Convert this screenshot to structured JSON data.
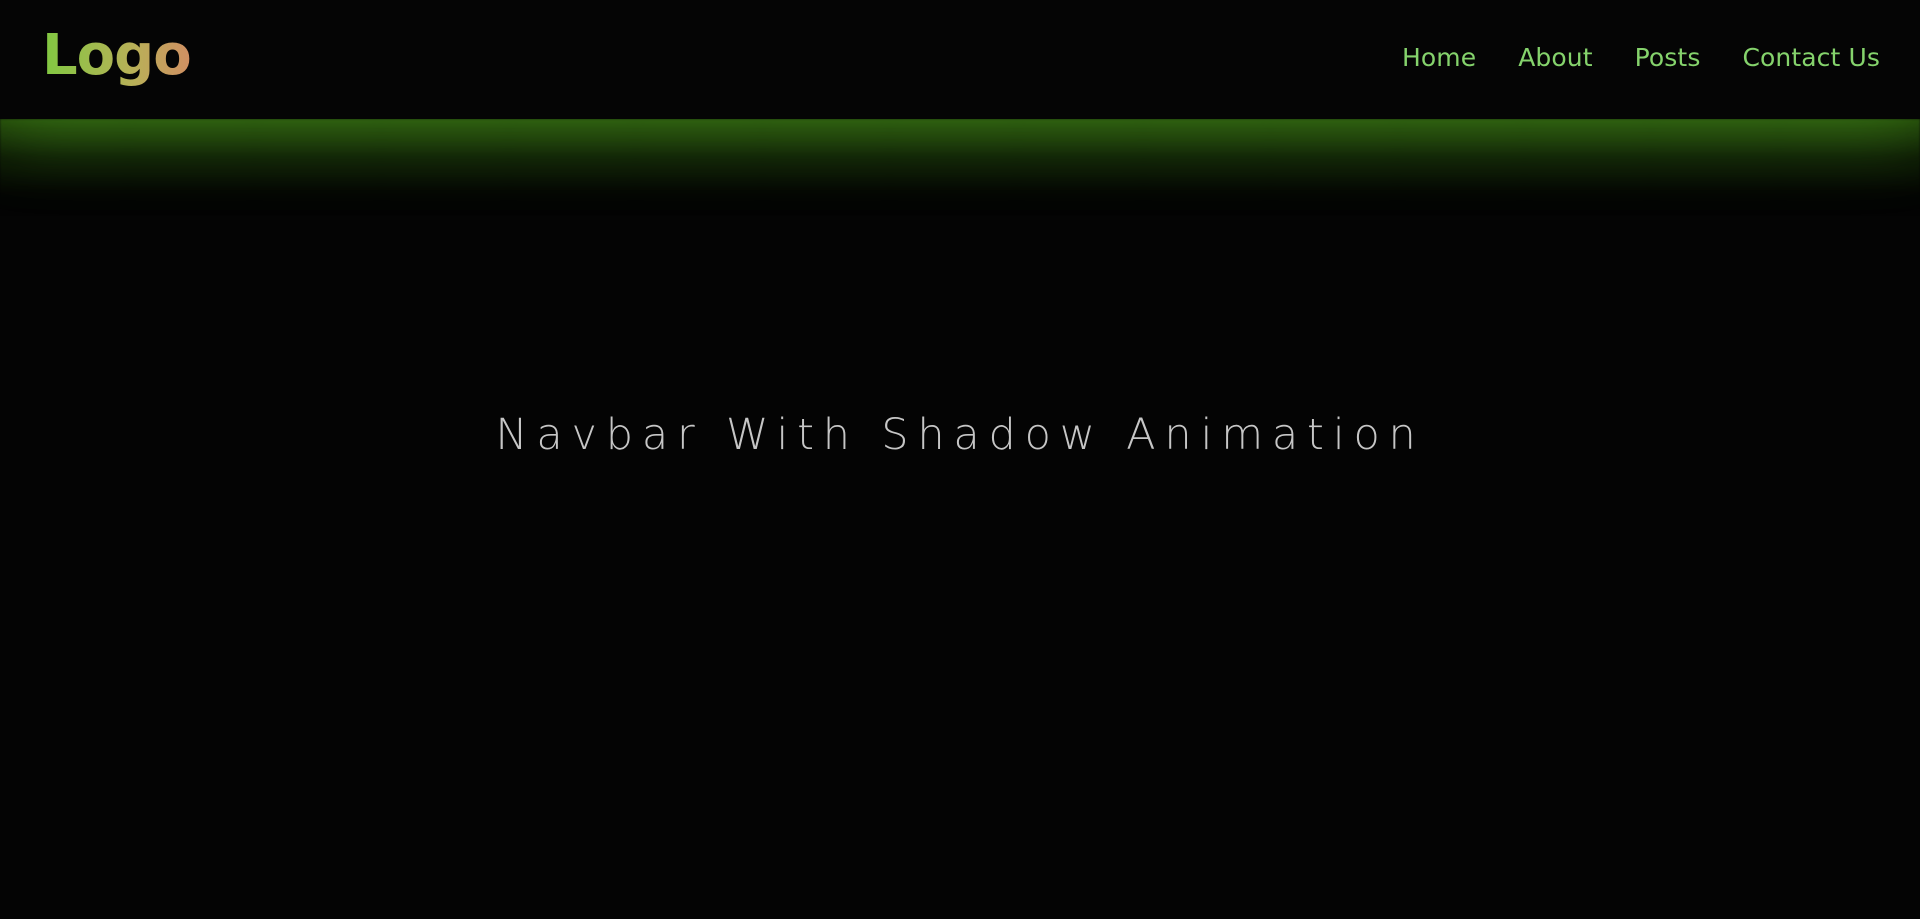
{
  "header": {
    "logo": "Logo",
    "nav": [
      {
        "label": "Home"
      },
      {
        "label": "About"
      },
      {
        "label": "Posts"
      },
      {
        "label": "Contact Us"
      }
    ]
  },
  "main": {
    "title": "Navbar With Shadow Animation"
  },
  "colors": {
    "background": "#040404",
    "nav_link": "#85d36c",
    "logo_start": "#80c941",
    "logo_end": "#d18f63",
    "shadow_glow": "#57b127",
    "title_text": "#c6c6c6"
  }
}
